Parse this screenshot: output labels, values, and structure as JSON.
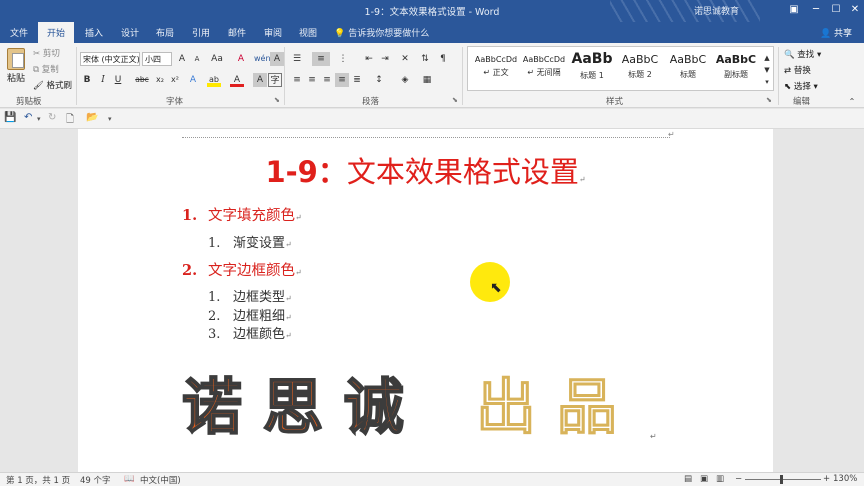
{
  "window": {
    "title": "1-9：文本效果格式设置 - Word",
    "account": "诺思诚教育",
    "buttons": {
      "ribbon_display": "▣",
      "minimize": "─",
      "maximize": "☐",
      "close": "✕"
    }
  },
  "tabs": [
    "文件",
    "开始",
    "插入",
    "设计",
    "布局",
    "引用",
    "邮件",
    "审阅",
    "视图"
  ],
  "active_tab": "开始",
  "tell_me": "告诉我你想要做什么",
  "share_label": "共享",
  "ribbon": {
    "clipboard": {
      "paste": "粘贴",
      "cut": "剪切",
      "copy": "复制",
      "format_painter": "格式刷",
      "group": "剪贴板"
    },
    "font": {
      "family": "宋体 (中文正文)",
      "size": "小四",
      "grow": "A",
      "shrink": "A",
      "case": "Aa",
      "clear": "A",
      "bold": "B",
      "italic": "I",
      "underline": "U",
      "strike": "abc",
      "sub": "x₂",
      "sup": "x²",
      "effects": "A",
      "highlight": "ab",
      "color": "A",
      "shading": "A",
      "border": "A",
      "group": "字体"
    },
    "paragraph": {
      "group": "段落"
    },
    "styles": {
      "group": "样式",
      "items": [
        {
          "sample": "AaBbCcDd",
          "name": "↵ 正文"
        },
        {
          "sample": "AaBbCcDd",
          "name": "↵ 无间隔"
        },
        {
          "sample": "AaBb",
          "name": "标题 1"
        },
        {
          "sample": "AaBbC",
          "name": "标题 2"
        },
        {
          "sample": "AaBbC",
          "name": "标题"
        },
        {
          "sample": "AaBbC",
          "name": "副标题"
        }
      ]
    },
    "editing": {
      "find": "查找",
      "replace": "替换",
      "select": "选择",
      "group": "编辑"
    }
  },
  "document": {
    "heading_num": "1-9：",
    "heading_text": "文本效果格式设置",
    "para_mark": "↵",
    "items": [
      {
        "num": "1.",
        "text": "文字填充颜色",
        "children": [
          {
            "num": "1.",
            "text": "渐变设置"
          }
        ]
      },
      {
        "num": "2.",
        "text": "文字边框颜色",
        "children": [
          {
            "num": "1.",
            "text": "边框类型"
          },
          {
            "num": "2.",
            "text": "边框粗细"
          },
          {
            "num": "3.",
            "text": "边框颜色"
          }
        ]
      }
    ],
    "art_solid": "诺 思 诚",
    "art_dotted": "出 品"
  },
  "status": {
    "page": "第 1 页，共 1 页",
    "words": "49 个字",
    "language": "中文(中国)",
    "zoom": "130%"
  },
  "colors": {
    "accent": "#2b579a",
    "heading": "#e0201b",
    "list_level1": "#d9221d",
    "highlight": "#ffe800"
  }
}
